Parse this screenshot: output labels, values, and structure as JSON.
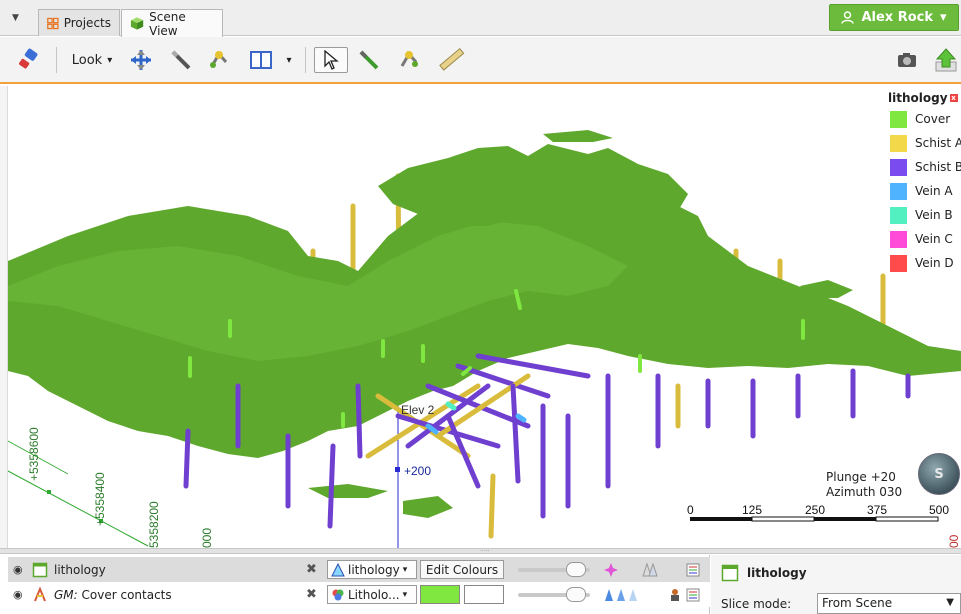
{
  "tabs": {
    "menu_glyph": "▼",
    "projects_label": "Projects",
    "scene_view_label": "Scene View"
  },
  "user": {
    "name": "Alex Rock",
    "dropdown_glyph": "▾"
  },
  "toolbar": {
    "look_label": "Look",
    "dropdown_glyph": "▾"
  },
  "legend": {
    "title": "lithology",
    "close_glyph": "x",
    "items": [
      {
        "label": "Cover",
        "color": "#80e640"
      },
      {
        "label": "Schist A",
        "color": "#f3d94a"
      },
      {
        "label": "Schist B",
        "color": "#7a4cf0"
      },
      {
        "label": "Vein A",
        "color": "#4fb3ff"
      },
      {
        "label": "Vein B",
        "color": "#52f0c0"
      },
      {
        "label": "Vein C",
        "color": "#ff4bd8"
      },
      {
        "label": "Vein D",
        "color": "#ff4b4b"
      }
    ]
  },
  "scene": {
    "plunge": "Plunge +20",
    "azimuth": "Azimuth 030",
    "compass_letter": "S",
    "elevation_label": "Elev 2",
    "elevation_value": "+200",
    "grid_labels": [
      "+5358600",
      "+5358400",
      "5358200",
      "000"
    ],
    "right_grid_label": "00",
    "scale_labels": [
      "0",
      "125",
      "250",
      "375",
      "500"
    ]
  },
  "layers": [
    {
      "name": "lithology",
      "prefix": "",
      "dropdown": "lithology",
      "action": "Edit Colours"
    },
    {
      "name": "Cover contacts",
      "prefix": "GM:",
      "dropdown": "Litholo..."
    }
  ],
  "properties": {
    "title": "lithology",
    "slice_mode_label": "Slice mode:",
    "slice_mode_value": "From Scene"
  },
  "colors": {
    "accent_orange": "#f2a23c",
    "user_green": "#6cbb3c",
    "surface_green": "#5fa82e",
    "drill_yellow": "#d9bc3c",
    "drill_purple": "#6f3fd0"
  }
}
